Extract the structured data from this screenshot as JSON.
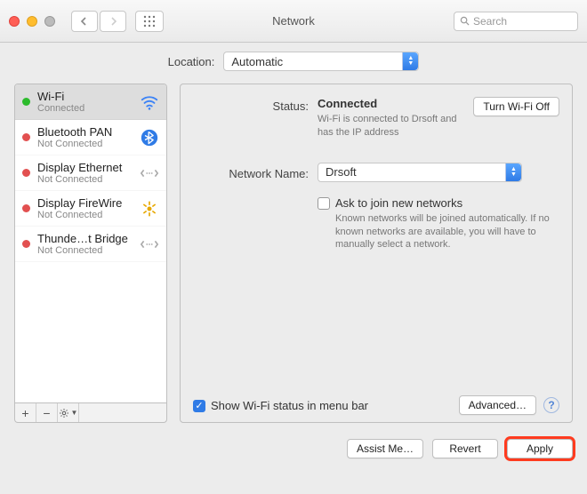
{
  "titlebar": {
    "title": "Network",
    "search_placeholder": "Search"
  },
  "location": {
    "label": "Location:",
    "value": "Automatic"
  },
  "sidebar": {
    "items": [
      {
        "name": "Wi-Fi",
        "sub": "Connected",
        "status": "green",
        "icon": "wifi",
        "selected": true
      },
      {
        "name": "Bluetooth PAN",
        "sub": "Not Connected",
        "status": "red",
        "icon": "bluetooth"
      },
      {
        "name": "Display Ethernet",
        "sub": "Not Connected",
        "status": "red",
        "icon": "ethernet"
      },
      {
        "name": "Display FireWire",
        "sub": "Not Connected",
        "status": "red",
        "icon": "firewire"
      },
      {
        "name": "Thunde…t Bridge",
        "sub": "Not Connected",
        "status": "red",
        "icon": "ethernet"
      }
    ],
    "add_label": "+",
    "remove_label": "−",
    "gear_label": "✻▾"
  },
  "detail": {
    "status_label": "Status:",
    "status_value": "Connected",
    "turn_off_label": "Turn Wi-Fi Off",
    "status_desc": "Wi-Fi is connected to Drsoft and has the IP address",
    "network_name_label": "Network Name:",
    "network_name_value": "Drsoft",
    "ask_join_label": "Ask to join new networks",
    "ask_join_desc": "Known networks will be joined automatically. If no known networks are available, you will have to manually select a network.",
    "show_status_label": "Show Wi-Fi status in menu bar",
    "advanced_label": "Advanced…",
    "help_label": "?"
  },
  "footer": {
    "assist": "Assist Me…",
    "revert": "Revert",
    "apply": "Apply"
  }
}
